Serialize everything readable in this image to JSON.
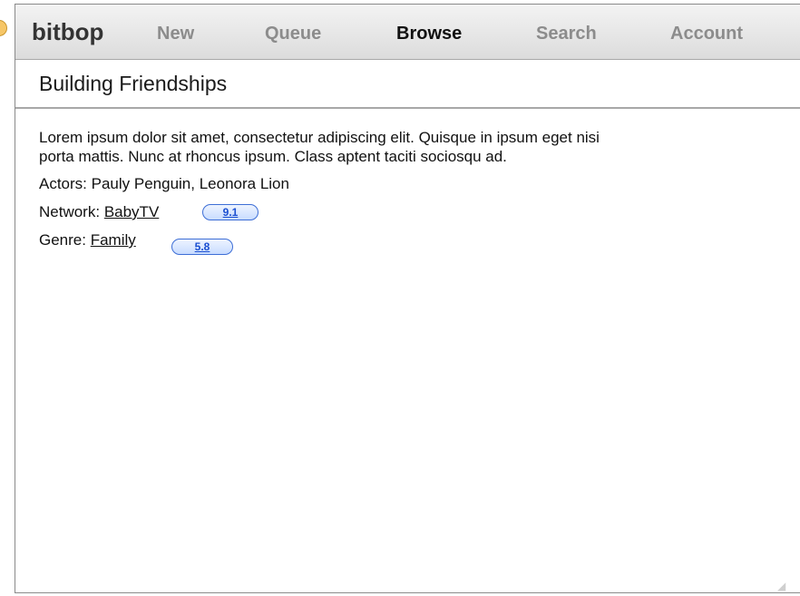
{
  "nav": {
    "logo": "bitbop",
    "items": [
      {
        "label": "New"
      },
      {
        "label": "Queue"
      },
      {
        "label": "Browse"
      },
      {
        "label": "Search"
      },
      {
        "label": "Account"
      }
    ],
    "active": "Browse"
  },
  "page": {
    "title": "Building Friendships"
  },
  "details": {
    "description_line1": "Lorem ipsum dolor sit amet, consectetur adipiscing elit. Quisque in ipsum eget nisi",
    "description_line2": "porta mattis. Nunc at rhoncus ipsum. Class aptent taciti sociosqu ad.",
    "actors_label": "Actors: Pauly Penguin, Leonora Lion",
    "network_label": "Network:",
    "network_value": "BabyTV",
    "network_rating": "9.1",
    "genre_label": "Genre:",
    "genre_value": "Family",
    "genre_rating": "5.8"
  },
  "colors": {
    "pill_border": "#3d6ed6",
    "pill_text": "#1b4fd1",
    "active_nav": "#111111",
    "inactive_nav": "#8c8c8c"
  }
}
